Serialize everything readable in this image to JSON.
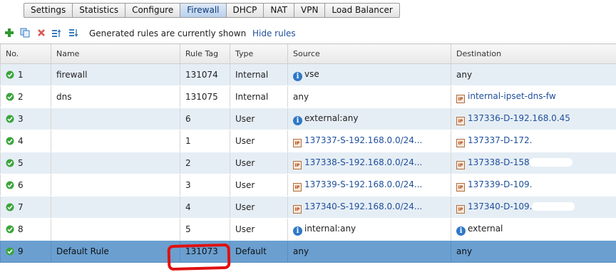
{
  "tabs": [
    "Settings",
    "Statistics",
    "Configure",
    "Firewall",
    "DHCP",
    "NAT",
    "VPN",
    "Load Balancer"
  ],
  "active_tab": "Firewall",
  "toolbar": {
    "icons": [
      "add-icon",
      "copy-icon",
      "delete-icon",
      "move-up-icon",
      "move-down-icon"
    ],
    "status": "Generated rules are currently shown",
    "hide_link": "Hide rules"
  },
  "columns": [
    "No.",
    "Name",
    "Rule Tag",
    "Type",
    "Source",
    "Destination"
  ],
  "rows": [
    {
      "no": "1",
      "name": "firewall",
      "tag": "131074",
      "type": "Internal",
      "src": "vse",
      "src_icon": "info",
      "dst": "any",
      "dst_icon": ""
    },
    {
      "no": "2",
      "name": "dns",
      "tag": "131075",
      "type": "Internal",
      "src": "any",
      "src_icon": "",
      "dst": "internal-ipset-dns-fw",
      "dst_icon": "ipset"
    },
    {
      "no": "3",
      "name": "",
      "tag": "6",
      "type": "User",
      "src": "external:any",
      "src_icon": "info",
      "dst": "137336-D-192.168.0.45",
      "dst_icon": "ipset"
    },
    {
      "no": "4",
      "name": "",
      "tag": "1",
      "type": "User",
      "src": "137337-S-192.168.0.0/24...",
      "src_icon": "ipset",
      "dst": "137337-D-172.",
      "dst_icon": "ipset"
    },
    {
      "no": "5",
      "name": "",
      "tag": "2",
      "type": "User",
      "src": "137338-S-192.168.0.0/24...",
      "src_icon": "ipset",
      "dst": "137338-D-158",
      "dst_icon": "ipset"
    },
    {
      "no": "6",
      "name": "",
      "tag": "3",
      "type": "User",
      "src": "137339-S-192.168.0.0/24...",
      "src_icon": "ipset",
      "dst": "137339-D-109.",
      "dst_icon": "ipset"
    },
    {
      "no": "7",
      "name": "",
      "tag": "4",
      "type": "User",
      "src": "137340-S-192.168.0.0/24...",
      "src_icon": "ipset",
      "dst": "137340-D-109.",
      "dst_icon": "ipset"
    },
    {
      "no": "8",
      "name": "",
      "tag": "5",
      "type": "User",
      "src": "internal:any",
      "src_icon": "info",
      "dst": "external",
      "dst_icon": "info"
    },
    {
      "no": "9",
      "name": "Default Rule",
      "tag": "131073",
      "type": "Default",
      "src": "any",
      "src_icon": "",
      "dst": "any",
      "dst_icon": "",
      "selected": true
    }
  ],
  "colors": {
    "accent": "#1f4f9a",
    "selected_row": "#6a9fd0",
    "alt_row": "#e6eef5",
    "annotation": "#e01010"
  }
}
